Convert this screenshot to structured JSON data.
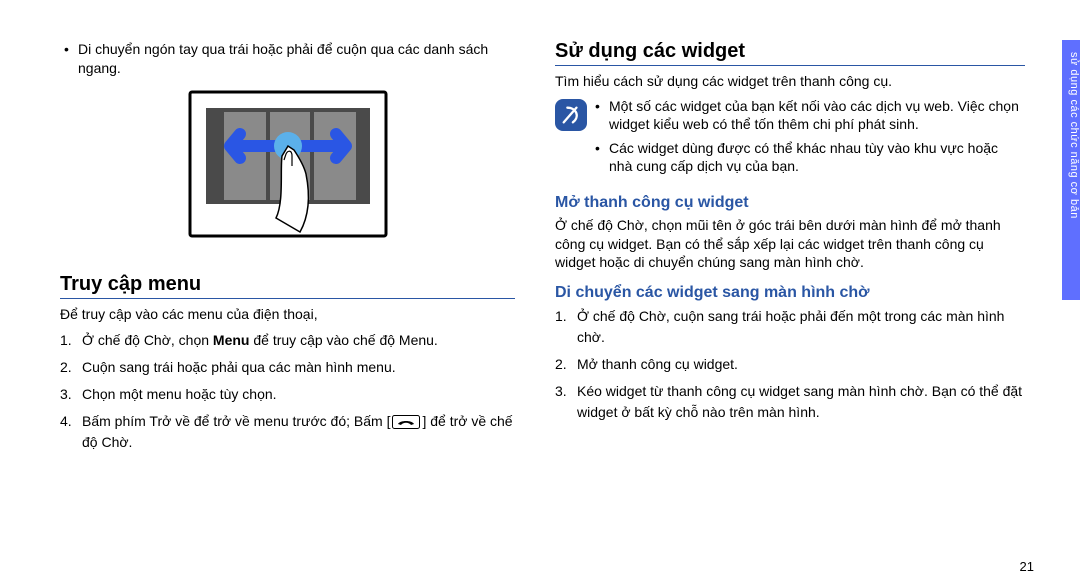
{
  "side_tab": "sử dụng các chức năng cơ bản",
  "page_number": "21",
  "left": {
    "intro_bullet": "Di chuyển ngón tay qua trái hoặc phải để cuộn qua các danh sách ngang.",
    "heading": "Truy cập menu",
    "para": "Để truy cập vào các menu của điện thoại,",
    "items": {
      "i1_pre": "Ở chế độ Chờ, chọn ",
      "i1_bold": "Menu",
      "i1_post": " để truy cập vào chế độ Menu.",
      "i2": "Cuộn sang trái hoặc phải qua các màn hình menu.",
      "i3": "Chọn một menu hoặc tùy chọn.",
      "i4_pre": "Bấm phím Trở về để trở về menu trước đó; Bấm [",
      "i4_post": "] để trở về chế độ Chờ."
    }
  },
  "right": {
    "heading": "Sử dụng các widget",
    "para": "Tìm hiểu cách sử dụng các widget trên thanh công cụ.",
    "notes": {
      "n1": "Một số các widget của bạn kết nối vào các dịch vụ web. Việc chọn widget kiểu web có thể tốn thêm chi phí phát sinh.",
      "n2": "Các widget dùng được có thể khác nhau tùy vào khu vực hoặc nhà cung cấp dịch vụ của bạn."
    },
    "sub1": "Mở thanh công cụ widget",
    "sub1_para": "Ở chế độ Chờ, chọn mũi tên ở góc trái bên dưới màn hình để mở thanh công cụ widget. Bạn có thể sắp xếp lại các widget trên thanh công cụ widget hoặc di chuyển chúng sang màn hình chờ.",
    "sub2": "Di chuyển các widget sang màn hình chờ",
    "sub2_items": {
      "i1": "Ở chế độ Chờ, cuộn sang trái hoặc phải đến một trong các màn hình chờ.",
      "i2": "Mở thanh công cụ widget.",
      "i3": "Kéo widget từ thanh công cụ widget sang màn hình chờ. Bạn có thể đặt widget ở bất kỳ chỗ nào trên màn hình."
    }
  }
}
